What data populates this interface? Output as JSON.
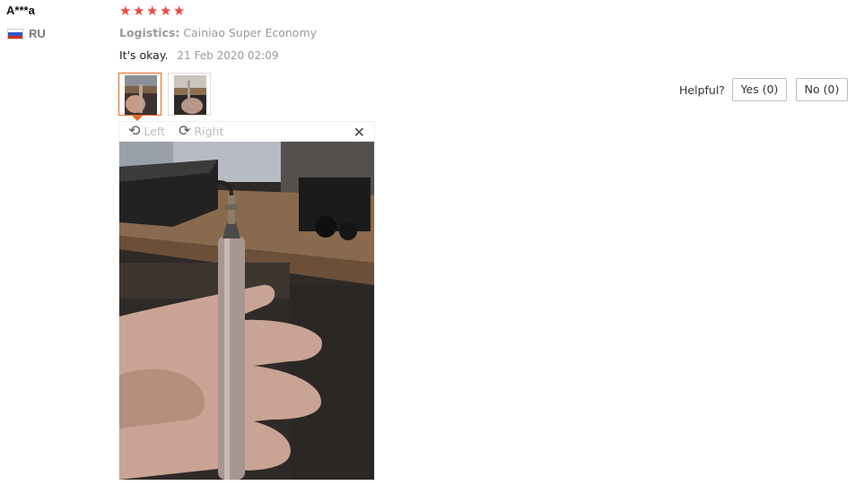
{
  "reviewer": {
    "name": "A***a",
    "country": "RU"
  },
  "rating": {
    "stars": 5,
    "star_glyph": "★",
    "color": "#f1453d"
  },
  "logistics": {
    "label": "Logistics:",
    "value": "Cainiao Super Economy"
  },
  "review": {
    "text": "It's okay.",
    "date": "21 Feb 2020 02:09"
  },
  "helpful": {
    "label": "Helpful?",
    "yes": "Yes (0)",
    "no": "No (0)"
  },
  "viewer": {
    "left_label": "Left",
    "right_label": "Right",
    "rotate_left_icon": "⟲",
    "rotate_right_icon": "⟳",
    "close_icon": "✕"
  },
  "colors": {
    "accent": "#e66a22",
    "muted": "#999999"
  }
}
